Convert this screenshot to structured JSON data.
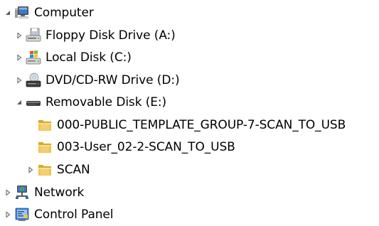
{
  "tree": {
    "items": [
      {
        "label": "Computer",
        "icon": "computer-icon",
        "expanded": true
      },
      {
        "label": "Floppy Disk Drive (A:)",
        "icon": "floppy-drive-icon",
        "expanded": false
      },
      {
        "label": "Local Disk (C:)",
        "icon": "windows-disk-icon",
        "expanded": false
      },
      {
        "label": "DVD/CD-RW Drive (D:)",
        "icon": "dvd-drive-icon",
        "expanded": false
      },
      {
        "label": "Removable Disk (E:)",
        "icon": "usb-drive-icon",
        "expanded": true
      },
      {
        "label": "000-PUBLIC_TEMPLATE_GROUP-7-SCAN_TO_USB",
        "icon": "folder-icon"
      },
      {
        "label": "003-User_02-2-SCAN_TO_USB",
        "icon": "folder-icon"
      },
      {
        "label": "SCAN",
        "icon": "folder-icon",
        "expanded": false
      },
      {
        "label": "Network",
        "icon": "network-icon",
        "expanded": false
      },
      {
        "label": "Control Panel",
        "icon": "control-panel-icon",
        "expanded": false
      }
    ]
  },
  "colors": {
    "expander": "#595959",
    "folder": "#f1c550",
    "folder_dark": "#d8a72a",
    "monitor": "#3b78c9",
    "text": "#000000"
  }
}
